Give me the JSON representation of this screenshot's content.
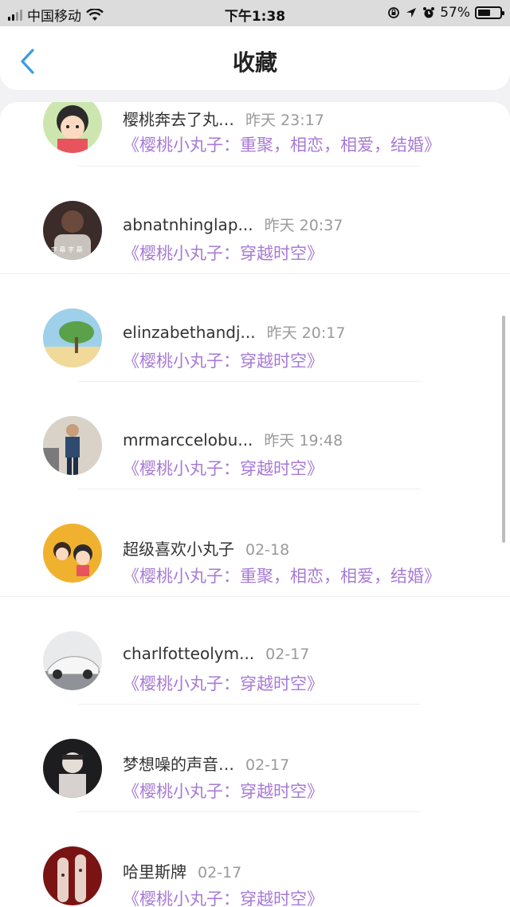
{
  "status_bar": {
    "carrier": "中国移动",
    "time": "下午1:38",
    "battery": "57%",
    "battery_level": 0.57,
    "icons": [
      "signal-icon",
      "wifi-icon",
      "lock-rotation-icon",
      "location-icon",
      "alarm-icon",
      "battery-icon"
    ]
  },
  "header": {
    "back_icon": "chevron-left-icon",
    "title": "收藏"
  },
  "colors": {
    "accent": "#3c9be0",
    "topic": "#a77ad6",
    "time": "#9a9a9a"
  },
  "favorites": [
    {
      "name": "樱桃奔去了丸…",
      "time": "昨天 23:17",
      "topic": "《樱桃小丸子：重聚，相恋，相爱，结婚》"
    },
    {
      "name": "abnatnhinglap...",
      "time": "昨天 20:37",
      "topic": "《樱桃小丸子：穿越时空》"
    },
    {
      "name": "elinzabethandj...",
      "time": "昨天 20:17",
      "topic": "《樱桃小丸子：穿越时空》"
    },
    {
      "name": "mrmarccelobu...",
      "time": "昨天 19:48",
      "topic": "《樱桃小丸子：穿越时空》"
    },
    {
      "name": "超级喜欢小丸子",
      "time": "02-18",
      "topic": "《樱桃小丸子：重聚，相恋，相爱，结婚》"
    },
    {
      "name": "charlfotteolym...",
      "time": "02-17",
      "topic": "《樱桃小丸子：穿越时空》"
    },
    {
      "name": "梦想噪的声音…",
      "time": "02-17",
      "topic": "《樱桃小丸子：穿越时空》"
    },
    {
      "name": "哈里斯牌",
      "time": "02-17",
      "topic": "《樱桃小丸子：穿越时空》"
    }
  ]
}
